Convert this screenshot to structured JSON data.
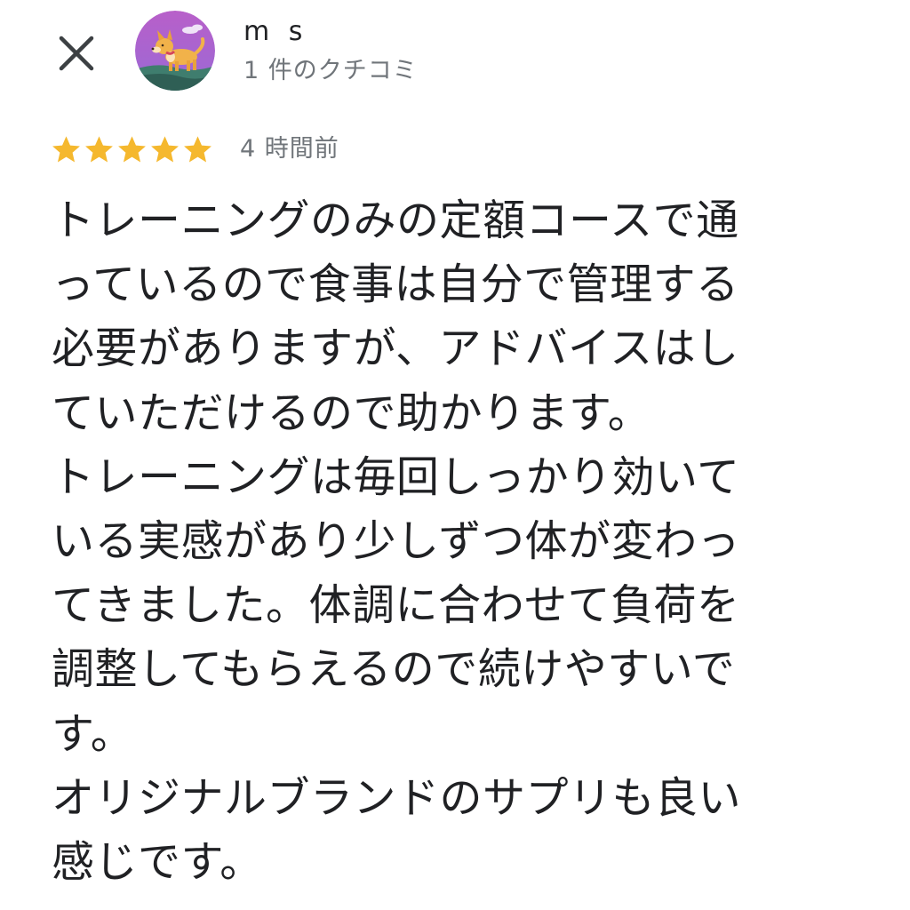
{
  "header": {
    "close_icon": "close-icon",
    "avatar_icon": "dog-avatar-icon",
    "reviewer_name": "m s",
    "review_count": "1 件のクチコミ"
  },
  "review": {
    "rating": 5,
    "max_rating": 5,
    "star_color": "#f5b82e",
    "time": "4 時間前",
    "lines": [
      "トレーニングのみの定額コースで通",
      "っているので食事は自分で管理する",
      "必要がありますが、アドバイスはし",
      "ていただけるので助かります。",
      "トレーニングは毎回しっかり効いて",
      "いる実感があり少しずつ体が変わっ",
      "てきました。体調に合わせて負荷を",
      "調整してもらえるので続けやすいで",
      "す。",
      "オリジナルブランドのサプリも良い",
      "感じです。"
    ]
  }
}
